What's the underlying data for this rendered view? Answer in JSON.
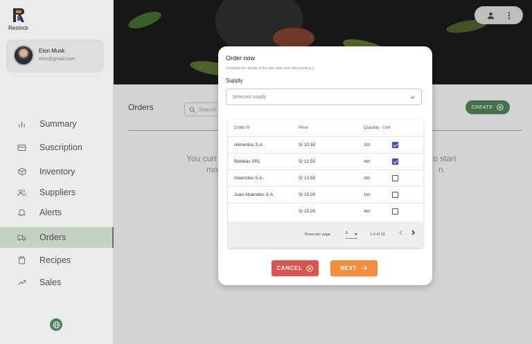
{
  "app": {
    "name": "Restock"
  },
  "user": {
    "name": "Elon Musk",
    "email": "elon@gmail.com"
  },
  "sidebar": {
    "items": [
      {
        "label": "Summary",
        "icon": "bar-chart-icon"
      },
      {
        "label": "Suscription",
        "icon": "credit-card-icon"
      },
      {
        "label": "Inventory",
        "icon": "box-icon"
      },
      {
        "label": "Suppliers",
        "icon": "users-icon"
      },
      {
        "label": "Alerts",
        "icon": "bell-icon"
      },
      {
        "label": "Orders",
        "icon": "truck-icon",
        "active": true
      },
      {
        "label": "Recipes",
        "icon": "clipboard-icon"
      },
      {
        "label": "Sales",
        "icon": "trending-up-icon"
      }
    ]
  },
  "page": {
    "title": "Orders",
    "search_placeholder": "Search",
    "create_label": "CREATE",
    "empty_left": "You curr",
    "empty_left2": "mo",
    "empty_right": "to start",
    "empty_right2": "n."
  },
  "modal": {
    "title": "Order now",
    "subtitle": "Complete the details of the new order and start tracking it.",
    "supply_label": "Supply",
    "supply_placeholder": "Selected supply",
    "columns": [
      "Order N°",
      "Price",
      "Quantity - Unit"
    ],
    "rows": [
      {
        "name": "Alimentos S.A.",
        "price": "S/ 10.50",
        "qty": "320",
        "checked": true
      },
      {
        "name": "Bebidas SRL",
        "price": "S/ 12.50",
        "qty": "400",
        "checked": true
      },
      {
        "name": "Abarrotes S.A.",
        "price": "S/ 13.50",
        "qty": "200",
        "checked": false
      },
      {
        "name": "Juan Abarrates S.A.",
        "price": "S/ 15.00",
        "qty": "150",
        "checked": false
      },
      {
        "name": "",
        "price": "S/ 15.00",
        "qty": "400",
        "checked": false
      }
    ],
    "pagination": {
      "rows_per_page_label": "Rows per page",
      "rows_per_page": "5",
      "range": "1-5 of 10"
    },
    "cancel_label": "CANCEL",
    "next_label": "NEXT"
  },
  "colors": {
    "accent": "#4d7a51",
    "cancel": "#d9534f",
    "next": "#f28e3c",
    "checkbox": "#3f51b5"
  }
}
